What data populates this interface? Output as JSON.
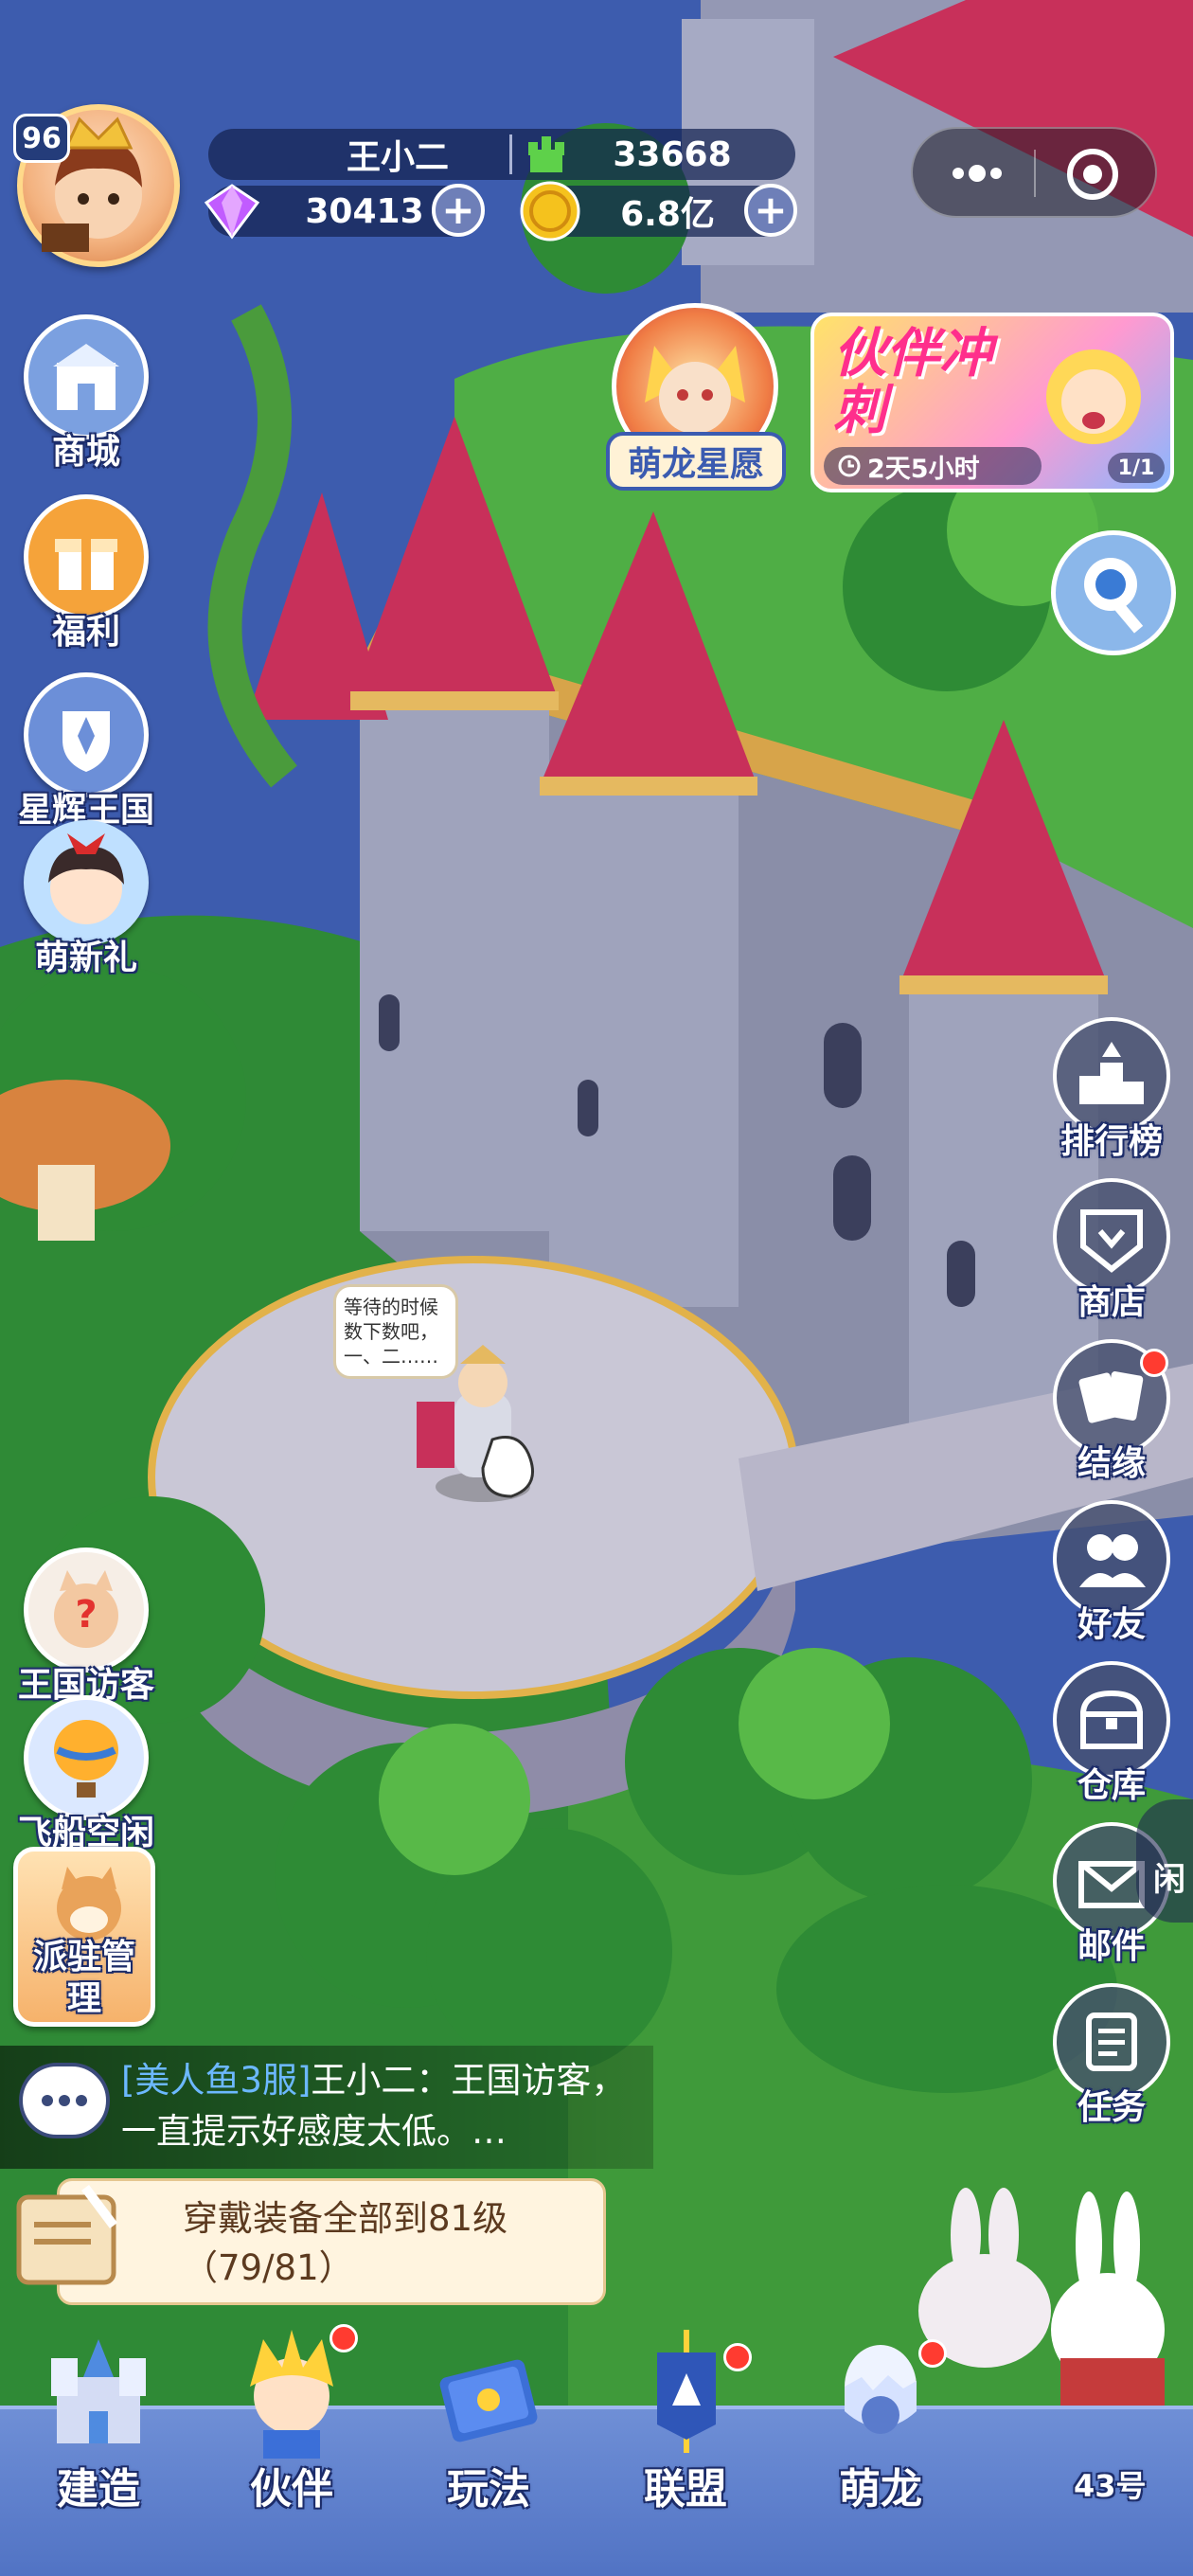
{
  "player": {
    "name": "王小二",
    "level": "96",
    "power": "33668",
    "diamonds": "30413",
    "gold": "6.8亿",
    "plus": "+"
  },
  "events": {
    "dragon_wish": "萌龙星愿",
    "partner_sprint_title": "伙伴冲刺",
    "partner_sprint_timer": "2天5小时",
    "partner_sprint_page": "1/1"
  },
  "left_menu": [
    {
      "label": "商城"
    },
    {
      "label": "福利"
    },
    {
      "label": "星辉王国"
    },
    {
      "label": "萌新礼"
    },
    {
      "label": "王国访客"
    },
    {
      "label": "飞船空闲"
    },
    {
      "label": "派驻管理"
    }
  ],
  "right_menu": [
    {
      "label": "排行榜"
    },
    {
      "label": "商店"
    },
    {
      "label": "结缘"
    },
    {
      "label": "好友"
    },
    {
      "label": "仓库"
    },
    {
      "label": "邮件"
    },
    {
      "label": "任务"
    }
  ],
  "idle_tag": "闲",
  "npc_bubble": "等待的时候数下数吧，一、二……",
  "chat": {
    "channel": "[美人鱼3服]",
    "message": "王小二：王国访客，一直提示好感度太低。…"
  },
  "task": {
    "title": "穿戴装备全部到81级",
    "progress": "（79/81）"
  },
  "bottom_nav": [
    {
      "label": "建造"
    },
    {
      "label": "伙伴"
    },
    {
      "label": "玩法"
    },
    {
      "label": "联盟"
    },
    {
      "label": "萌龙"
    }
  ],
  "server_tag": "43号",
  "colors": {
    "sky": "#3d5cae",
    "grass": "#3f9a3a",
    "castle_wall": "#8a8ea8",
    "roof": "#c8305a",
    "navbar": "#5a7bcc",
    "red_dot": "#ff3b30"
  }
}
